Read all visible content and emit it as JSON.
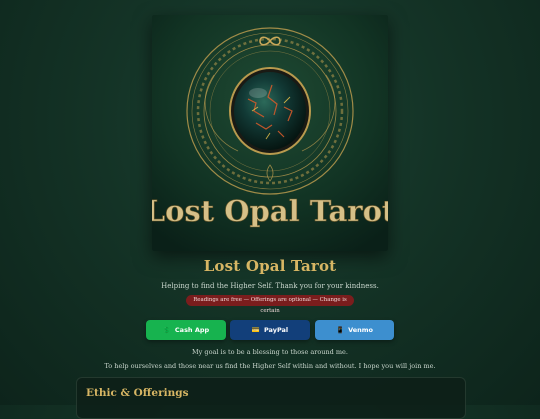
{
  "hero": {
    "logo_text": "Lost Opal Tarot",
    "infinity_icon": "infinity-icon",
    "opal_icon": "opal-orb"
  },
  "site": {
    "title": "Lost Opal Tarot",
    "tagline": "Helping to find the Higher Self. Thank you for your kindness."
  },
  "badge": {
    "text": "Readings are free — Offerings are optional — Change is certain"
  },
  "payments": [
    {
      "label": "Cash App",
      "icon": "dollar-icon",
      "glyph": "💲",
      "color": "#17b34f"
    },
    {
      "label": "PayPal",
      "icon": "card-icon",
      "glyph": "💳",
      "color": "#123f7a"
    },
    {
      "label": "Venmo",
      "icon": "phone-icon",
      "glyph": "📱",
      "color": "#3d8fcf"
    }
  ],
  "intro": {
    "line1": "My goal is to be a blessing to those around me.",
    "line2": "To help ourselves and those near us find the Higher Self within and without. I hope you will join me."
  },
  "sections": {
    "ethic_title": "Ethic & Offerings"
  },
  "colors": {
    "gold": "#d7b664",
    "background": "#143326",
    "badge": "#7a1d1d"
  }
}
